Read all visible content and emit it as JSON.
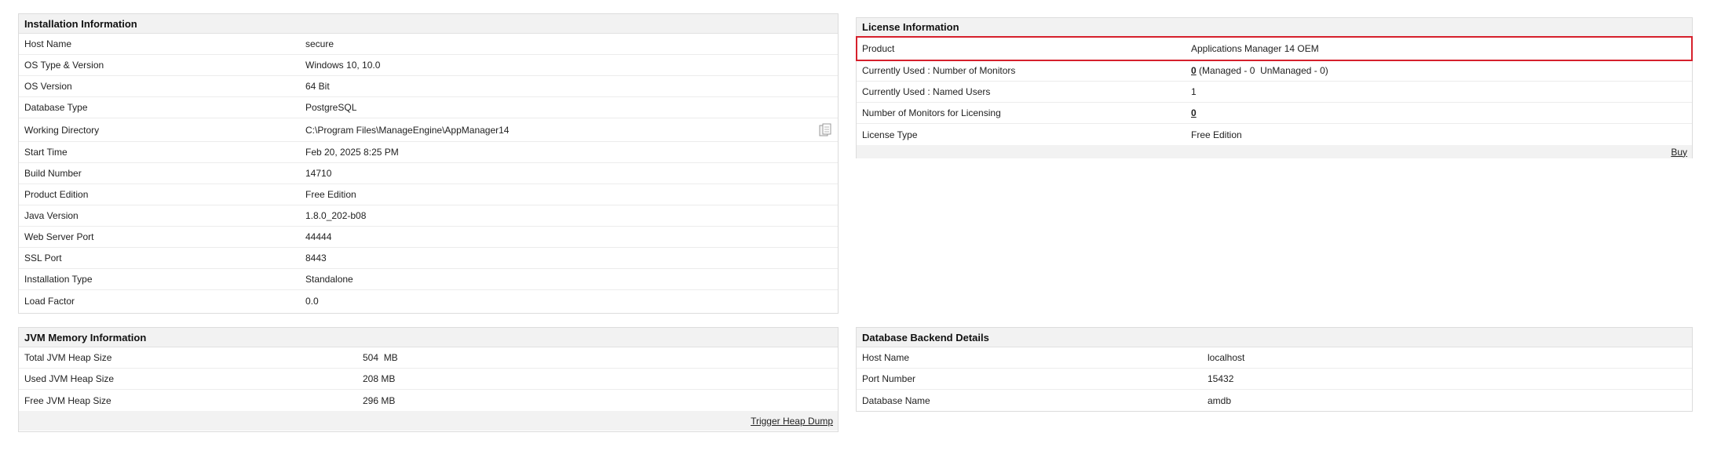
{
  "installation": {
    "title": "Installation Information",
    "rows": [
      {
        "label": "Host Name",
        "value": "secure"
      },
      {
        "label": "OS Type & Version",
        "value": "Windows 10, 10.0"
      },
      {
        "label": "OS Version",
        "value": "64 Bit"
      },
      {
        "label": "Database Type",
        "value": "PostgreSQL"
      },
      {
        "label": "Working Directory",
        "value": "C:\\Program Files\\ManageEngine\\AppManager14"
      },
      {
        "label": "Start Time",
        "value": "Feb 20, 2025 8:25 PM"
      },
      {
        "label": "Build Number",
        "value": "14710"
      },
      {
        "label": "Product Edition",
        "value": "Free Edition"
      },
      {
        "label": "Java Version",
        "value": "1.8.0_202-b08"
      },
      {
        "label": "Web Server Port",
        "value": "44444"
      },
      {
        "label": "SSL Port",
        "value": "8443"
      },
      {
        "label": "Installation Type",
        "value": "Standalone"
      },
      {
        "label": "Load Factor",
        "value": "0.0"
      }
    ],
    "copy_icon": "copy-icon"
  },
  "license": {
    "title": "License Information",
    "rows": [
      {
        "label": "Product",
        "value": "Applications Manager 14 OEM"
      },
      {
        "label": "Currently Used : Number of Monitors",
        "value_link": "0",
        "value_rest": " (Managed - 0  UnManaged - 0)"
      },
      {
        "label": "Currently Used : Named Users",
        "value": "1"
      },
      {
        "label": "Number of Monitors for Licensing",
        "value_link": "0"
      },
      {
        "label": "License Type",
        "value": "Free Edition"
      }
    ],
    "buy_label": "Buy"
  },
  "jvm": {
    "title": "JVM Memory Information",
    "rows": [
      {
        "label": "Total JVM Heap Size",
        "value": "504  MB"
      },
      {
        "label": "Used JVM Heap Size",
        "value": "208 MB"
      },
      {
        "label": "Free JVM Heap Size",
        "value": "296 MB"
      }
    ],
    "trigger_label": "Trigger Heap Dump"
  },
  "db": {
    "title": "Database Backend Details",
    "rows": [
      {
        "label": "Host Name",
        "value": "localhost"
      },
      {
        "label": "Port Number",
        "value": "15432"
      },
      {
        "label": "Database Name",
        "value": "amdb"
      }
    ]
  },
  "colors": {
    "highlight": "#d6202c",
    "header_bg": "#f2f2f2"
  }
}
